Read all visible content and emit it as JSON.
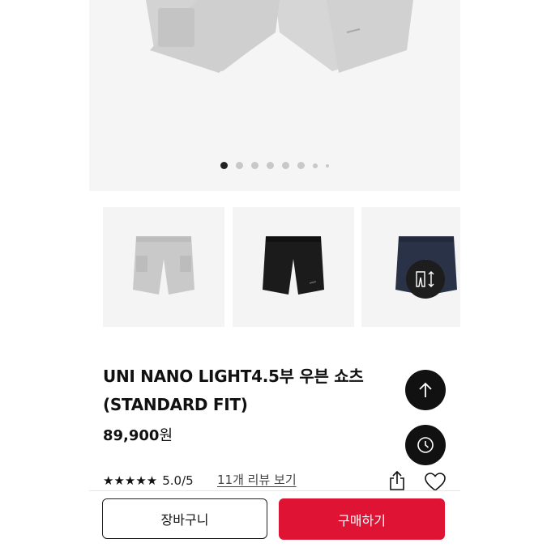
{
  "gallery": {
    "dot_count": 8,
    "active_index": 0
  },
  "thumbnails": [
    {
      "color_name": "light-gray",
      "color": "#c9c9c9"
    },
    {
      "color_name": "black",
      "color": "#1b1b1b"
    },
    {
      "color_name": "navy",
      "color": "#2a3247"
    }
  ],
  "product": {
    "title_line1": "UNI NANO LIGHT4.5부 우븐 쇼츠",
    "title_line2": "(STANDARD FIT)",
    "price_number": "89,900",
    "price_unit": "원",
    "stars": "★★★★★",
    "rating": "5.0/5",
    "review_link": "11개 리뷰 보기"
  },
  "buttons": {
    "cart": "장바구니",
    "buy": "구매하기"
  },
  "icons": {
    "fit": "size-fit-icon",
    "up": "arrow-up-icon",
    "recent": "clock-icon",
    "share": "share-icon",
    "like": "heart-icon"
  },
  "colors": {
    "accent": "#df1435",
    "underline": "#d9152b",
    "fab": "#111111"
  }
}
